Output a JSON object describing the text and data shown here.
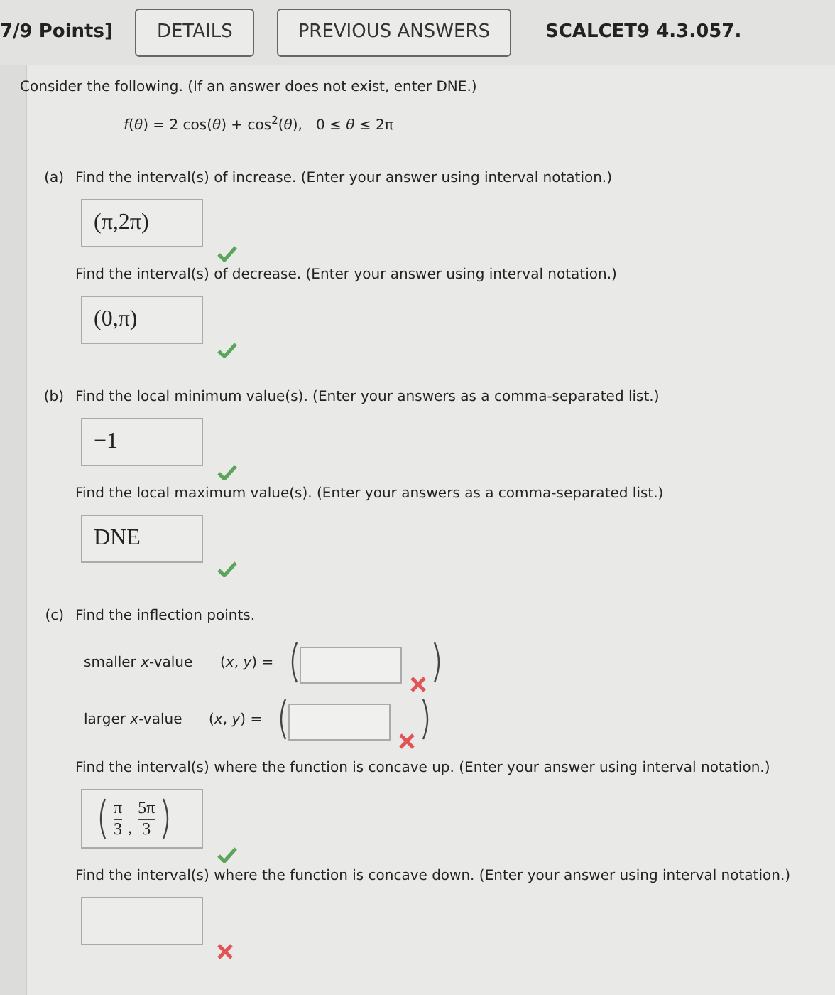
{
  "header": {
    "points": "7/9 Points]",
    "buttons": [
      "DETAILS",
      "PREVIOUS ANSWERS"
    ],
    "code": "SCALCET9 4.3.057."
  },
  "intro": "Consider the following. (If an answer does not exist, enter DNE.)",
  "formula": "*f*(*θ*) = 2 cos(*θ*) + cos$^{2}$(*θ*),   0 ≤ *θ* ≤ 2π",
  "parts": [
    {
      "label": "(a)",
      "items": [
        {
          "kind": "answer",
          "prompt": "Find the interval(s) of increase. (Enter your answer using interval notation.)",
          "value": "(π,2π)",
          "correct": true
        },
        {
          "kind": "answer",
          "prompt": "Find the interval(s) of decrease. (Enter your answer using interval notation.)",
          "value": "(0,π)",
          "correct": true
        }
      ]
    },
    {
      "label": "(b)",
      "items": [
        {
          "kind": "answer",
          "prompt": "Find the local minimum value(s). (Enter your answers as a comma-separated list.)",
          "value": "−1",
          "correct": true
        },
        {
          "kind": "answer",
          "prompt": "Find the local maximum value(s). (Enter your answers as a comma-separated list.)",
          "value": "DNE",
          "correct": true
        }
      ]
    },
    {
      "label": "(c)",
      "items": [
        {
          "kind": "heading",
          "prompt": "Find the inflection points."
        },
        {
          "kind": "point",
          "label": "smaller *x*-value",
          "coord": "(*x*, *y*) =",
          "correct": false
        },
        {
          "kind": "point",
          "label": "larger *x*-value",
          "coord": "(*x*, *y*) =",
          "correct": false
        },
        {
          "kind": "fraction",
          "prompt": "Find the interval(s) where the function is concave up. (Enter your answer using interval notation.)",
          "fractions": [
            {
              "num": "π",
              "den": "3"
            },
            {
              "num": "5π",
              "den": "3"
            }
          ],
          "separator": ",",
          "correct": true
        },
        {
          "kind": "answer",
          "prompt": "Find the interval(s) where the function is concave down. (Enter your answer using interval notation.)",
          "correct": false
        }
      ]
    }
  ]
}
